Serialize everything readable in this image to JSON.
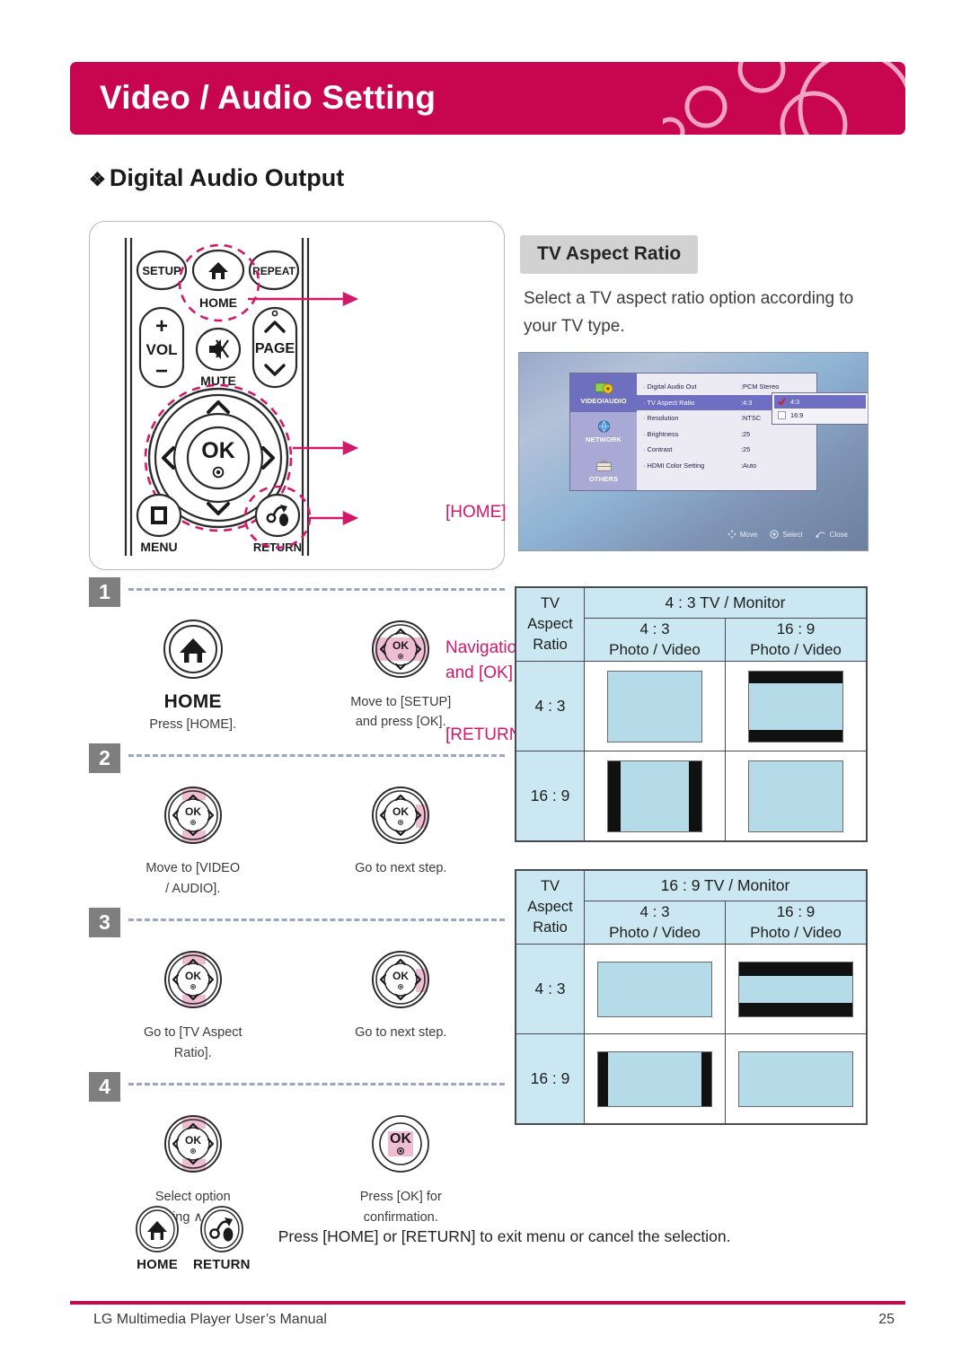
{
  "banner": {
    "title": "Video / Audio Setting"
  },
  "section": {
    "bullet": "❖",
    "heading": "Digital Audio Output"
  },
  "remote": {
    "buttons": {
      "setup": "SETUP",
      "home": "HOME",
      "repeat": "REPEAT",
      "vol": "VOL",
      "plus": "+",
      "minus": "−",
      "mute": "MUTE",
      "page": "PAGE",
      "ok": "OK",
      "menu": "MENU",
      "return": "RETURN"
    },
    "callouts": {
      "home": "[HOME]",
      "nav_line1": "Navigation button",
      "nav_line2": "and [OK]",
      "return": "[RETURN]"
    }
  },
  "right": {
    "tag": "TV Aspect Ratio",
    "description": "Select a TV aspect ratio option according to your TV type."
  },
  "osd": {
    "sidebar": [
      {
        "label": "VIDEO/AUDIO",
        "icon": "video-audio-icon",
        "active": true
      },
      {
        "label": "NETWORK",
        "icon": "globe-icon",
        "active": false
      },
      {
        "label": "OTHERS",
        "icon": "briefcase-icon",
        "active": false
      }
    ],
    "rows": [
      {
        "label": "· Digital Audio Out",
        "value": ":PCM Stereo",
        "active": false
      },
      {
        "label": "· TV Aspect Ratio",
        "value": ":4:3",
        "active": true
      },
      {
        "label": "· Resolution",
        "value": ":NTSC",
        "active": false
      },
      {
        "label": "· Brightness",
        "value": ":25",
        "active": false
      },
      {
        "label": "· Contrast",
        "value": ":25",
        "active": false
      },
      {
        "label": "· HDMI Color Setting",
        "value": ":Auto",
        "active": false
      }
    ],
    "popup": [
      {
        "label": "4:3",
        "selected": true
      },
      {
        "label": "16:9",
        "selected": false
      }
    ],
    "status": [
      {
        "icon": "dpad-icon",
        "label": "Move"
      },
      {
        "icon": "ok-icon",
        "label": "Select"
      },
      {
        "icon": "return-icon",
        "label": "Close"
      }
    ]
  },
  "steps": [
    {
      "number": "1",
      "left": {
        "icon": "home-button-icon",
        "big_label": "HOME",
        "caption": "Press [HOME]."
      },
      "right": {
        "icon": "dpad-lr-ok-icon",
        "caption": "Move to [SETUP]\nand press [OK]."
      }
    },
    {
      "number": "2",
      "left": {
        "icon": "dpad-updown-icon",
        "caption": "Move to [VIDEO\n/ AUDIO]."
      },
      "right": {
        "icon": "dpad-right-icon",
        "caption": "Go to next step."
      }
    },
    {
      "number": "3",
      "left": {
        "icon": "dpad-updown-icon",
        "caption": "Go to [TV Aspect\nRatio]."
      },
      "right": {
        "icon": "dpad-right-icon",
        "caption": "Go to next step."
      }
    },
    {
      "number": "4",
      "left": {
        "icon": "dpad-updown-icon",
        "caption": "Select option\nusing ∧ / ∨."
      },
      "right": {
        "icon": "ok-button-icon",
        "caption": "Press [OK] for\nconfirmation."
      }
    }
  ],
  "tables": [
    {
      "corner_line1": "TV",
      "corner_line2": "Aspect",
      "corner_line3": "Ratio",
      "monitor_title": "4 : 3 TV / Monitor",
      "columns": [
        {
          "ratio": "4 : 3",
          "kind": "Photo / Video"
        },
        {
          "ratio": "16 : 9",
          "kind": "Photo / Video"
        }
      ],
      "rows": [
        {
          "label": "4 : 3",
          "cells": [
            {
              "frame": "4:3",
              "fit": "full"
            },
            {
              "frame": "4:3",
              "fit": "letterbox"
            }
          ]
        },
        {
          "label": "16 : 9",
          "cells": [
            {
              "frame": "4:3",
              "fit": "pillarbox"
            },
            {
              "frame": "4:3",
              "fit": "full"
            }
          ]
        }
      ]
    },
    {
      "corner_line1": "TV",
      "corner_line2": "Aspect",
      "corner_line3": "Ratio",
      "monitor_title": "16 : 9 TV / Monitor",
      "columns": [
        {
          "ratio": "4 : 3",
          "kind": "Photo / Video"
        },
        {
          "ratio": "16 : 9",
          "kind": "Photo / Video"
        }
      ],
      "rows": [
        {
          "label": "4 : 3",
          "cells": [
            {
              "frame": "16:9",
              "fit": "full"
            },
            {
              "frame": "16:9",
              "fit": "letterbox"
            }
          ]
        },
        {
          "label": "16 : 9",
          "cells": [
            {
              "frame": "16:9",
              "fit": "pillarbox"
            },
            {
              "frame": "16:9",
              "fit": "full"
            }
          ]
        }
      ]
    }
  ],
  "note": {
    "home_label": "HOME",
    "return_label": "RETURN",
    "text": "Press [HOME] or [RETURN] to exit menu or cancel the selection."
  },
  "footer": {
    "left": "LG Multimedia Player User’s Manual",
    "page": "25"
  },
  "colors": {
    "brand": "#c8064f",
    "callout": "#d2186b",
    "highlight_pink": "#efbdd2",
    "table_header": "#cbe7f1",
    "badge_gray": "#7f7f7f"
  }
}
